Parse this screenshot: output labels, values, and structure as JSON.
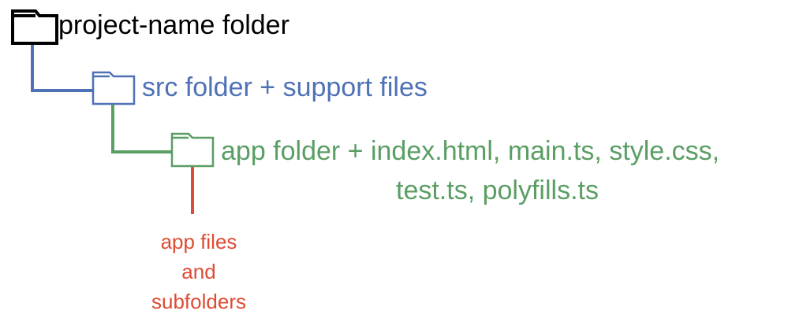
{
  "colors": {
    "root": "#000000",
    "src": "#4f71b6",
    "app": "#5a9e64",
    "files": "#de4b34"
  },
  "icons": {
    "root": "folder-icon",
    "src": "folder-icon",
    "app": "folder-icon"
  },
  "labels": {
    "root": "project-name folder",
    "src": "src folder + support files",
    "app_line1": "app folder + index.html, main.ts, style.css,",
    "app_line2": "test.ts, polyfills.ts",
    "files_line1": "app files",
    "files_line2": "and",
    "files_line3": "subfolders"
  }
}
